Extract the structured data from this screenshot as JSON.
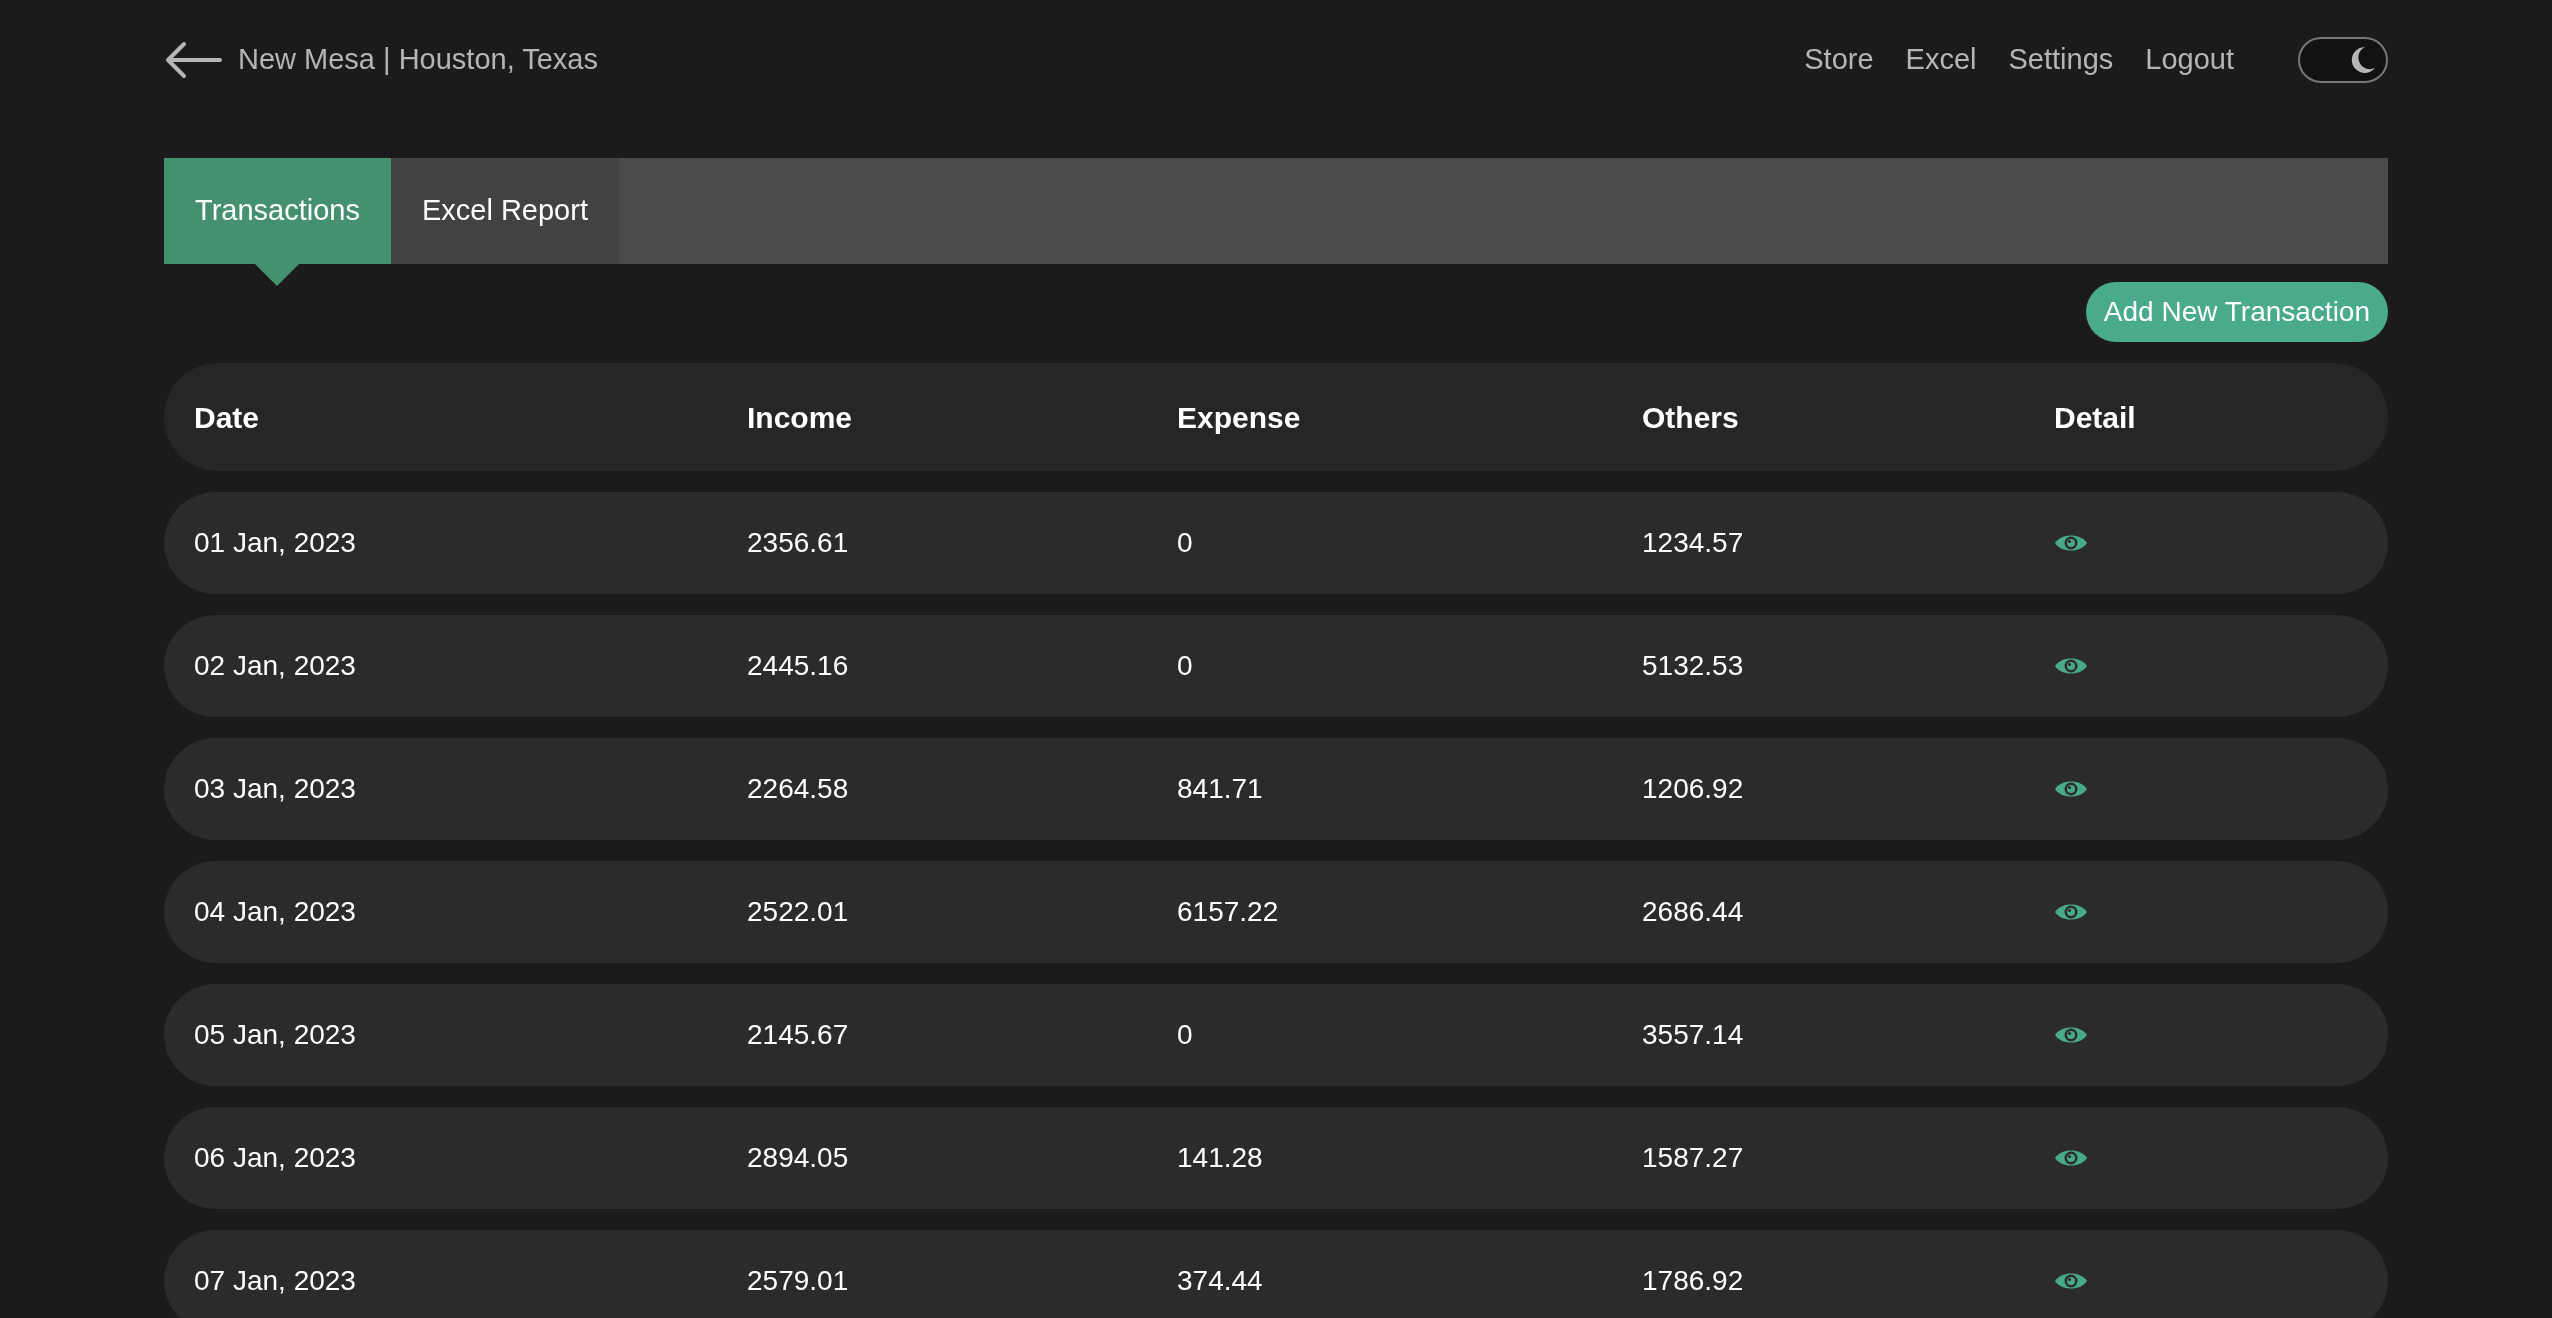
{
  "header": {
    "title": "New Mesa | Houston, Texas",
    "nav": [
      "Store",
      "Excel",
      "Settings",
      "Logout"
    ],
    "dark_mode": {
      "on": true
    }
  },
  "tabs": [
    {
      "label": "Transactions",
      "selected": true
    },
    {
      "label": "Excel Report",
      "selected": false
    }
  ],
  "add_button": "Add New Transaction",
  "table": {
    "columns": [
      "Date",
      "Income",
      "Expense",
      "Others",
      "Detail"
    ],
    "rows": [
      {
        "date": "01 Jan, 2023",
        "income": "2356.61",
        "expense": "0",
        "others": "1234.57"
      },
      {
        "date": "02 Jan, 2023",
        "income": "2445.16",
        "expense": "0",
        "others": "5132.53"
      },
      {
        "date": "03 Jan, 2023",
        "income": "2264.58",
        "expense": "841.71",
        "others": "1206.92"
      },
      {
        "date": "04 Jan, 2023",
        "income": "2522.01",
        "expense": "6157.22",
        "others": "2686.44"
      },
      {
        "date": "05 Jan, 2023",
        "income": "2145.67",
        "expense": "0",
        "others": "3557.14"
      },
      {
        "date": "06 Jan, 2023",
        "income": "2894.05",
        "expense": "141.28",
        "others": "1587.27"
      },
      {
        "date": "07 Jan, 2023",
        "income": "2579.01",
        "expense": "374.44",
        "others": "1786.92"
      }
    ]
  }
}
